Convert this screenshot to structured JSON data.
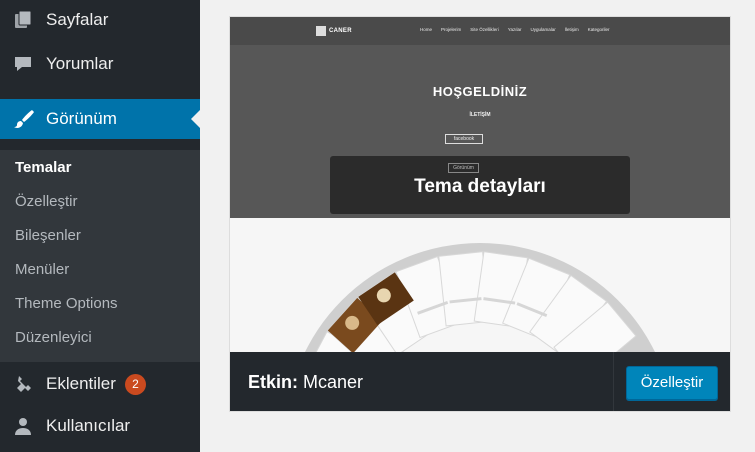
{
  "sidebar": {
    "pages": {
      "label": "Sayfalar",
      "icon": "pages-icon"
    },
    "comments": {
      "label": "Yorumlar",
      "icon": "comments-icon"
    },
    "appearance": {
      "label": "Görünüm",
      "icon": "paintbrush-icon"
    },
    "plugins": {
      "label": "Eklentiler",
      "icon": "plugin-icon",
      "badge": "2"
    },
    "users": {
      "label": "Kullanıcılar",
      "icon": "users-icon"
    },
    "submenu": {
      "themes": "Temalar",
      "customize": "Özelleştir",
      "widgets": "Bileşenler",
      "menus": "Menüler",
      "theme_options": "Theme Options",
      "editor": "Düzenleyici"
    }
  },
  "theme": {
    "screenshot": {
      "logo_text": "CANER",
      "nav_links": [
        "Home",
        "Projelerim",
        "Site Özellikleri",
        "Yazılar",
        "Uygulamalar",
        "İletişim",
        "Kategoriler"
      ],
      "hero_title": "HOŞGELDİNİZ",
      "hero_subtitle": "İLETİŞİM",
      "hero_button": "facebook",
      "overlay_mini_button": "Görünüm"
    },
    "details_label": "Tema detayları",
    "active_prefix": "Etkin:",
    "active_name": "Mcaner",
    "customize_label": "Özelleştir"
  },
  "colors": {
    "sidebar_bg": "#23282d",
    "submenu_bg": "#32373c",
    "accent": "#0073aa",
    "button": "#0085ba",
    "badge": "#ca4a1f"
  }
}
